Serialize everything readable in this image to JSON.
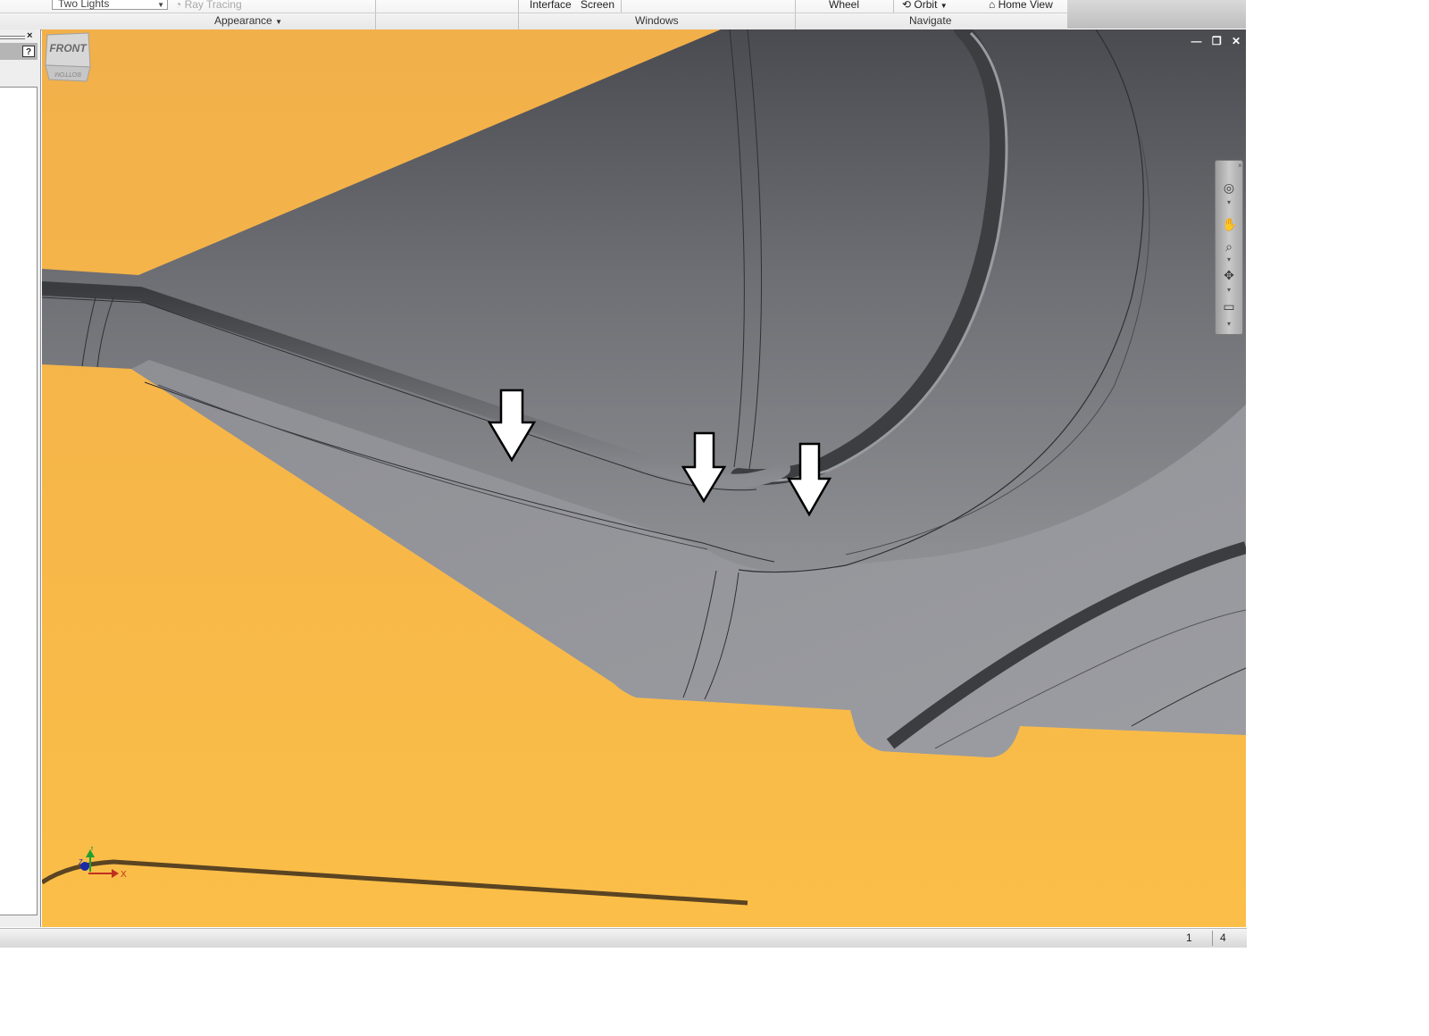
{
  "ribbon": {
    "lighting_select_value": "Two Lights",
    "ray_tracing_label": "Ray Tracing",
    "appearance_group": "Appearance",
    "user_interface_label": "Interface",
    "full_screen_label": "Screen",
    "windows_group": "Windows",
    "wheel_label": "Wheel",
    "orbit_label": "Orbit",
    "home_view_label": "Home View",
    "navigate_group": "Navigate"
  },
  "panel": {
    "close_glyph": "×",
    "help_glyph": "?"
  },
  "viewport": {
    "background_color": "#f7b648",
    "model_color": "#8e8f94",
    "window_buttons": [
      "—",
      "❐",
      "✕"
    ],
    "viewcube_face": "FRONT",
    "viewcube_bottom_face": "BOTTOM",
    "axis_labels": {
      "x": "X",
      "y": "Y",
      "z": "Z"
    },
    "annotation": "three downward arrows pointing at fillet edge"
  },
  "navbar": {
    "icons": [
      "steering-wheel-icon",
      "pan-icon",
      "zoom-icon",
      "orbit-icon",
      "look-at-icon"
    ]
  },
  "status": {
    "value_a": "1",
    "value_b": "4"
  }
}
